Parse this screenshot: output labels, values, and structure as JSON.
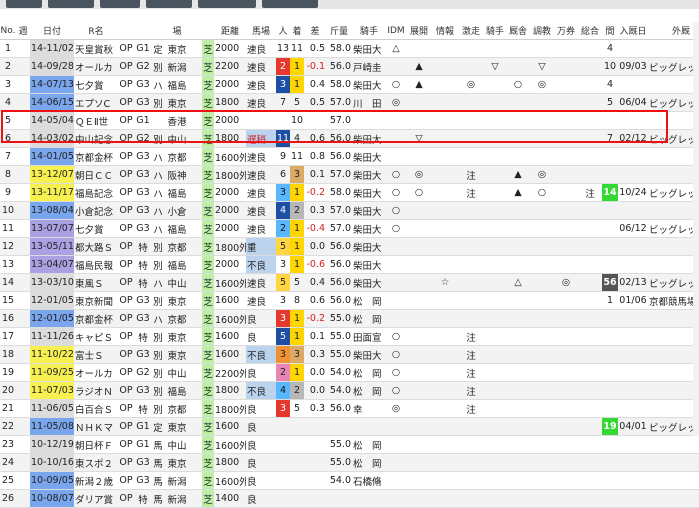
{
  "columns": [
    "No.",
    "週",
    "日付",
    "R名",
    "",
    "",
    "",
    "場",
    "",
    "",
    "距離",
    "馬場",
    "人",
    "着",
    "差",
    "斤量",
    "騎手",
    "IDM",
    "展開",
    "情報",
    "激走",
    "騎手",
    "厩舎",
    "調教",
    "万券",
    "総合",
    "間",
    "入厩日",
    "外厩"
  ],
  "rows": [
    {
      "no": "1",
      "week": "",
      "date": "14-11/02",
      "race": "天皇賞秋",
      "cls": "OP",
      "grade": "G1",
      "cond": "定",
      "venue": "東京",
      "surface": "芝",
      "dist": "2000",
      "state": "速良",
      "pop": "13",
      "place": "11",
      "margin": "0.5",
      "weight": "58.0",
      "jockey": "柴田大",
      "idm": "△",
      "dev": "",
      "info": "",
      "gekiso": "",
      "jk": "",
      "stable": "",
      "train": "",
      "man": "",
      "total": "",
      "gap": "4",
      "entry": "",
      "ext": ""
    },
    {
      "no": "2",
      "week": "",
      "date": "14-09/28",
      "race": "オールカ",
      "cls": "OP",
      "grade": "G2",
      "cond": "別",
      "venue": "新潟",
      "surface": "芝",
      "dist": "2200",
      "state": "速良",
      "pop": "2",
      "place": "1",
      "margin": "-0.1",
      "weight": "56.0",
      "jockey": "戸崎圭",
      "idm": "",
      "dev": "▲",
      "info": "",
      "gekiso": "",
      "jk": "▽",
      "stable": "",
      "train": "▽",
      "man": "",
      "total": "",
      "gap": "10",
      "entry": "09/03",
      "ext": "ビッグレッドF"
    },
    {
      "no": "3",
      "week": "",
      "date": "14-07/13",
      "race": "七夕賞",
      "cls": "OP",
      "grade": "G3",
      "cond": "ハ",
      "venue": "福島",
      "surface": "芝",
      "dist": "2000",
      "state": "速良",
      "pop": "3",
      "place": "1",
      "margin": "0.4",
      "weight": "58.0",
      "jockey": "柴田大",
      "idm": "○",
      "dev": "▲",
      "info": "",
      "gekiso": "◎",
      "jk": "",
      "stable": "○",
      "train": "◎",
      "man": "",
      "total": "",
      "gap": "4",
      "entry": "",
      "ext": ""
    },
    {
      "no": "4",
      "week": "",
      "date": "14-06/15",
      "race": "エプソC",
      "cls": "OP",
      "grade": "G3",
      "cond": "別",
      "venue": "東京",
      "surface": "芝",
      "dist": "1800",
      "state": "速良",
      "pop": "7",
      "place": "5",
      "margin": "0.5",
      "weight": "57.0",
      "jockey": "川　田",
      "idm": "◎",
      "dev": "",
      "info": "",
      "gekiso": "",
      "jk": "",
      "stable": "",
      "train": "",
      "man": "",
      "total": "",
      "gap": "5",
      "entry": "06/04",
      "ext": "ビッグレッドF"
    },
    {
      "no": "5",
      "week": "",
      "date": "14-05/04",
      "race": "ＱＥⅡ世",
      "cls": "OP",
      "grade": "G1",
      "cond": "",
      "venue": "香港",
      "surface": "芝",
      "dist": "2000",
      "state": "",
      "pop": "",
      "place": "10",
      "margin": "",
      "weight": "57.0",
      "jockey": "",
      "idm": "",
      "dev": "",
      "info": "",
      "gekiso": "",
      "jk": "",
      "stable": "",
      "train": "",
      "man": "",
      "total": "",
      "gap": "",
      "entry": "",
      "ext": ""
    },
    {
      "no": "6",
      "week": "",
      "date": "14-03/02",
      "race": "中山記念",
      "cls": "OP",
      "grade": "G2",
      "cond": "別",
      "venue": "中山",
      "surface": "芝",
      "dist": "1800",
      "state": "遅稍",
      "pop": "11",
      "place": "4",
      "margin": "0.6",
      "weight": "56.0",
      "jockey": "柴田大",
      "idm": "",
      "dev": "▽",
      "info": "",
      "gekiso": "",
      "jk": "",
      "stable": "",
      "train": "",
      "man": "",
      "total": "",
      "gap": "7",
      "entry": "02/12",
      "ext": "ビッグレッドF鉾田"
    },
    {
      "no": "7",
      "week": "",
      "date": "14-01/05",
      "race": "京都金杯",
      "cls": "OP",
      "grade": "G3",
      "cond": "ハ",
      "venue": "京都",
      "surface": "芝",
      "dist": "1600外",
      "state": "速良",
      "pop": "9",
      "place": "11",
      "margin": "0.8",
      "weight": "56.0",
      "jockey": "柴田大",
      "idm": "",
      "dev": "",
      "info": "",
      "gekiso": "",
      "jk": "",
      "stable": "",
      "train": "",
      "man": "",
      "total": "",
      "gap": "",
      "entry": "",
      "ext": ""
    },
    {
      "no": "8",
      "week": "",
      "date": "13-12/07",
      "race": "朝日ＣＣ",
      "cls": "OP",
      "grade": "G3",
      "cond": "ハ",
      "venue": "阪神",
      "surface": "芝",
      "dist": "1800外",
      "state": "速良",
      "pop": "6",
      "place": "3",
      "margin": "0.1",
      "weight": "57.0",
      "jockey": "柴田大",
      "idm": "○",
      "dev": "◎",
      "info": "",
      "gekiso": "注",
      "jk": "",
      "stable": "▲",
      "train": "◎",
      "man": "",
      "total": "",
      "gap": "",
      "entry": "",
      "ext": ""
    },
    {
      "no": "9",
      "week": "",
      "date": "13-11/17",
      "race": "福島記念",
      "cls": "OP",
      "grade": "G3",
      "cond": "ハ",
      "venue": "福島",
      "surface": "芝",
      "dist": "2000",
      "state": "速良",
      "pop": "3",
      "place": "1",
      "margin": "-0.2",
      "weight": "58.0",
      "jockey": "柴田大",
      "idm": "○",
      "dev": "○",
      "info": "",
      "gekiso": "注",
      "jk": "",
      "stable": "▲",
      "train": "○",
      "man": "",
      "total": "注",
      "gap": "14",
      "entry": "10/24",
      "ext": "ビッグレッドF鉾田"
    },
    {
      "no": "10",
      "week": "",
      "date": "13-08/04",
      "race": "小倉記念",
      "cls": "OP",
      "grade": "G3",
      "cond": "ハ",
      "venue": "小倉",
      "surface": "芝",
      "dist": "2000",
      "state": "速良",
      "pop": "4",
      "place": "2",
      "margin": "0.3",
      "weight": "57.0",
      "jockey": "柴田大",
      "idm": "○",
      "dev": "",
      "info": "",
      "gekiso": "",
      "jk": "",
      "stable": "",
      "train": "",
      "man": "",
      "total": "",
      "gap": "",
      "entry": "",
      "ext": ""
    },
    {
      "no": "11",
      "week": "",
      "date": "13-07/07",
      "race": "七夕賞",
      "cls": "OP",
      "grade": "G3",
      "cond": "ハ",
      "venue": "福島",
      "surface": "芝",
      "dist": "2000",
      "state": "速良",
      "pop": "2",
      "place": "1",
      "margin": "-0.4",
      "weight": "57.0",
      "jockey": "柴田大",
      "idm": "○",
      "dev": "",
      "info": "",
      "gekiso": "",
      "jk": "",
      "stable": "",
      "train": "",
      "man": "",
      "total": "",
      "gap": "",
      "entry": "06/12",
      "ext": "ビッグレッドF鉾田"
    },
    {
      "no": "12",
      "week": "",
      "date": "13-05/11",
      "race": "都大路Ｓ",
      "cls": "OP",
      "grade": "特",
      "cond": "別",
      "venue": "京都",
      "surface": "芝",
      "dist": "1800外",
      "state": "重",
      "pop": "5",
      "place": "1",
      "margin": "0.0",
      "weight": "56.0",
      "jockey": "柴田大",
      "idm": "",
      "dev": "",
      "info": "",
      "gekiso": "",
      "jk": "",
      "stable": "",
      "train": "",
      "man": "",
      "total": "",
      "gap": "",
      "entry": "",
      "ext": ""
    },
    {
      "no": "13",
      "week": "",
      "date": "13-04/07",
      "race": "福島民報",
      "cls": "OP",
      "grade": "特",
      "cond": "別",
      "venue": "福島",
      "surface": "芝",
      "dist": "2000",
      "state": "不良",
      "pop": "3",
      "place": "1",
      "margin": "-0.6",
      "weight": "56.0",
      "jockey": "柴田大",
      "idm": "",
      "dev": "",
      "info": "",
      "gekiso": "",
      "jk": "",
      "stable": "",
      "train": "",
      "man": "",
      "total": "",
      "gap": "",
      "entry": "",
      "ext": ""
    },
    {
      "no": "14",
      "week": "",
      "date": "13-03/10",
      "race": "東風Ｓ",
      "cls": "OP",
      "grade": "特",
      "cond": "ハ",
      "venue": "中山",
      "surface": "芝",
      "dist": "1600外",
      "state": "速良",
      "pop": "5",
      "place": "5",
      "margin": "0.4",
      "weight": "56.0",
      "jockey": "柴田大",
      "idm": "",
      "dev": "",
      "info": "☆",
      "gekiso": "",
      "jk": "",
      "stable": "△",
      "train": "",
      "man": "◎",
      "total": "",
      "gap": "56",
      "entry": "02/13",
      "ext": "ビッグレッドF鉾田"
    },
    {
      "no": "15",
      "week": "",
      "date": "12-01/05",
      "race": "東京新聞",
      "cls": "OP",
      "grade": "G3",
      "cond": "別",
      "venue": "東京",
      "surface": "芝",
      "dist": "1600",
      "state": "速良",
      "pop": "3",
      "place": "8",
      "margin": "0.6",
      "weight": "56.0",
      "jockey": "松　岡",
      "idm": "",
      "dev": "",
      "info": "",
      "gekiso": "",
      "jk": "",
      "stable": "",
      "train": "",
      "man": "",
      "total": "",
      "gap": "1",
      "entry": "01/06",
      "ext": "京都競馬場"
    },
    {
      "no": "16",
      "week": "",
      "date": "12-01/05",
      "race": "京都金杯",
      "cls": "OP",
      "grade": "G3",
      "cond": "ハ",
      "venue": "京都",
      "surface": "芝",
      "dist": "1600外",
      "state": "良",
      "pop": "3",
      "place": "1",
      "margin": "-0.2",
      "weight": "55.0",
      "jockey": "松　岡",
      "idm": "",
      "dev": "",
      "info": "",
      "gekiso": "",
      "jk": "",
      "stable": "",
      "train": "",
      "man": "",
      "total": "",
      "gap": "",
      "entry": "",
      "ext": ""
    },
    {
      "no": "17",
      "week": "",
      "date": "11-11/26",
      "race": "キャピＳ",
      "cls": "OP",
      "grade": "特",
      "cond": "別",
      "venue": "東京",
      "surface": "芝",
      "dist": "1600",
      "state": "良",
      "pop": "5",
      "place": "1",
      "margin": "0.1",
      "weight": "55.0",
      "jockey": "田面宣",
      "idm": "○",
      "dev": "",
      "info": "",
      "gekiso": "注",
      "jk": "",
      "stable": "",
      "train": "",
      "man": "",
      "total": "",
      "gap": "",
      "entry": "",
      "ext": ""
    },
    {
      "no": "18",
      "week": "",
      "date": "11-10/22",
      "race": "富士Ｓ",
      "cls": "OP",
      "grade": "G3",
      "cond": "別",
      "venue": "東京",
      "surface": "芝",
      "dist": "1600",
      "state": "不良",
      "pop": "3",
      "place": "3",
      "margin": "0.3",
      "weight": "55.0",
      "jockey": "柴田大",
      "idm": "○",
      "dev": "",
      "info": "",
      "gekiso": "注",
      "jk": "",
      "stable": "",
      "train": "",
      "man": "",
      "total": "",
      "gap": "",
      "entry": "",
      "ext": ""
    },
    {
      "no": "19",
      "week": "",
      "date": "11-09/25",
      "race": "オールカ",
      "cls": "OP",
      "grade": "G2",
      "cond": "別",
      "venue": "中山",
      "surface": "芝",
      "dist": "2200外",
      "state": "良",
      "pop": "2",
      "place": "1",
      "margin": "0.0",
      "weight": "54.0",
      "jockey": "松　岡",
      "idm": "○",
      "dev": "",
      "info": "",
      "gekiso": "注",
      "jk": "",
      "stable": "",
      "train": "",
      "man": "",
      "total": "",
      "gap": "",
      "entry": "",
      "ext": ""
    },
    {
      "no": "20",
      "week": "",
      "date": "11-07/03",
      "race": "ラジオＮ",
      "cls": "OP",
      "grade": "G3",
      "cond": "別",
      "venue": "福島",
      "surface": "芝",
      "dist": "1800",
      "state": "不良",
      "pop": "4",
      "place": "2",
      "margin": "0.0",
      "weight": "54.0",
      "jockey": "松　岡",
      "idm": "○",
      "dev": "",
      "info": "",
      "gekiso": "注",
      "jk": "",
      "stable": "",
      "train": "",
      "man": "",
      "total": "",
      "gap": "",
      "entry": "",
      "ext": ""
    },
    {
      "no": "21",
      "week": "",
      "date": "11-06/05",
      "race": "白百合Ｓ",
      "cls": "OP",
      "grade": "特",
      "cond": "別",
      "venue": "京都",
      "surface": "芝",
      "dist": "1800外",
      "state": "良",
      "pop": "3",
      "place": "5",
      "margin": "0.3",
      "weight": "56.0",
      "jockey": "幸　　",
      "idm": "◎",
      "dev": "",
      "info": "",
      "gekiso": "注",
      "jk": "",
      "stable": "",
      "train": "",
      "man": "",
      "total": "",
      "gap": "",
      "entry": "",
      "ext": ""
    },
    {
      "no": "22",
      "week": "",
      "date": "11-05/08",
      "race": "ＮＨＫマ",
      "cls": "OP",
      "grade": "G1",
      "cond": "定",
      "venue": "東京",
      "surface": "芝",
      "dist": "1600",
      "state": "良",
      "pop": "",
      "place": "",
      "margin": "",
      "weight": "",
      "jockey": "",
      "idm": "",
      "dev": "",
      "info": "",
      "gekiso": "",
      "jk": "",
      "stable": "",
      "train": "",
      "man": "",
      "total": "",
      "gap": "19",
      "entry": "04/01",
      "ext": "ビッグレッドF鉾田"
    },
    {
      "no": "23",
      "week": "",
      "date": "10-12/19",
      "race": "朝日杯Ｆ",
      "cls": "OP",
      "grade": "G1",
      "cond": "馬",
      "venue": "中山",
      "surface": "芝",
      "dist": "1600外",
      "state": "良",
      "pop": "",
      "place": "",
      "margin": "",
      "weight": "55.0",
      "jockey": "松　岡",
      "idm": "",
      "dev": "",
      "info": "",
      "gekiso": "",
      "jk": "",
      "stable": "",
      "train": "",
      "man": "",
      "total": "",
      "gap": "",
      "entry": "",
      "ext": ""
    },
    {
      "no": "24",
      "week": "",
      "date": "10-10/16",
      "race": "東スポ２",
      "cls": "OP",
      "grade": "G3",
      "cond": "馬",
      "venue": "東京",
      "surface": "芝",
      "dist": "1800",
      "state": "良",
      "pop": "",
      "place": "",
      "margin": "",
      "weight": "55.0",
      "jockey": "松　岡",
      "idm": "",
      "dev": "",
      "info": "",
      "gekiso": "",
      "jk": "",
      "stable": "",
      "train": "",
      "man": "",
      "total": "",
      "gap": "",
      "entry": "",
      "ext": ""
    },
    {
      "no": "25",
      "week": "",
      "date": "10-09/05",
      "race": "新潟２歳",
      "cls": "OP",
      "grade": "G3",
      "cond": "馬",
      "venue": "新潟",
      "surface": "芝",
      "dist": "1600外",
      "state": "良",
      "pop": "",
      "place": "",
      "margin": "",
      "weight": "54.0",
      "jockey": "石橋脩",
      "idm": "",
      "dev": "",
      "info": "",
      "gekiso": "",
      "jk": "",
      "stable": "",
      "train": "",
      "man": "",
      "total": "",
      "gap": "",
      "entry": "",
      "ext": ""
    },
    {
      "no": "26",
      "week": "",
      "date": "10-08/07",
      "race": "ダリア賞",
      "cls": "OP",
      "grade": "特",
      "cond": "馬",
      "venue": "新潟",
      "surface": "芝",
      "dist": "1400",
      "state": "良",
      "pop": "",
      "place": "",
      "margin": "",
      "weight": "",
      "jockey": "",
      "idm": "",
      "dev": "",
      "info": "",
      "gekiso": "",
      "jk": "",
      "stable": "",
      "train": "",
      "man": "",
      "total": "",
      "gap": "",
      "entry": "",
      "ext": ""
    }
  ],
  "row_styles": {
    "date_color": [
      "gray",
      "gray",
      "blue",
      "blue",
      "gray",
      "gray",
      "blue",
      "yellow",
      "yellow",
      "blue",
      "purple",
      "purple",
      "purple",
      "gray",
      "gray",
      "blue",
      "gray",
      "yellow",
      "yellow",
      "yellow",
      "gray",
      "blue",
      "gray",
      "gray",
      "blue",
      "blue"
    ],
    "place_color": [
      "",
      "p1",
      "p1",
      "",
      "",
      "",
      "",
      "p3",
      "p1",
      "p2",
      "p1",
      "p1",
      "p1",
      "",
      "",
      "p1",
      "p1",
      "p3",
      "p1",
      "p2",
      "",
      "",
      "",
      "",
      "",
      ""
    ],
    "pop_color": [
      "",
      "w3",
      "w4",
      "",
      "",
      "w4",
      "",
      "",
      "w2",
      "w4",
      "w2",
      "w5",
      "",
      "w5",
      "",
      "w3",
      "w4",
      "w7",
      "w8",
      "w2",
      "w3",
      "",
      "",
      "",
      "",
      ""
    ],
    "state_bad": [
      false,
      false,
      false,
      false,
      false,
      true,
      false,
      false,
      false,
      false,
      false,
      true,
      true,
      false,
      false,
      false,
      false,
      true,
      false,
      true,
      false,
      false,
      false,
      false,
      false,
      false
    ]
  },
  "colors": {
    "highlight_border": "#ee1111",
    "header_text": "#333333"
  }
}
